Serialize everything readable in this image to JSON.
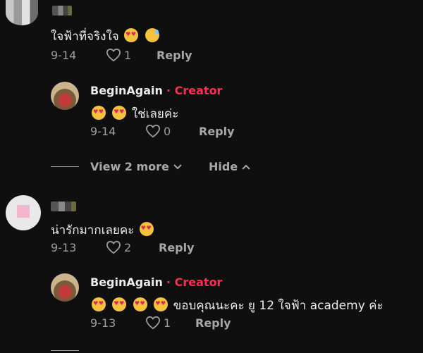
{
  "comments": [
    {
      "text": "ใจฟ้าที่จริงใจ",
      "emojis": [
        "heart-eyes-emoji",
        "sweat-smile-emoji"
      ],
      "date": "9-14",
      "likes": "1",
      "reply_label": "Reply",
      "replies": [
        {
          "username": "BeginAgain",
          "creator_label": "· Creator",
          "text": "ใช่เลยค่ะ",
          "emojis": [
            "heart-eyes-emoji",
            "heart-eyes-emoji"
          ],
          "date": "9-14",
          "likes": "0",
          "reply_label": "Reply"
        }
      ],
      "view_more_label": "View 2 more",
      "hide_label": "Hide"
    },
    {
      "text": "น่ารักมากเลยคะ",
      "emojis": [
        "heart-eyes-emoji"
      ],
      "date": "9-13",
      "likes": "2",
      "reply_label": "Reply",
      "replies": [
        {
          "username": "BeginAgain",
          "creator_label": "· Creator",
          "text": "ขอบคุณนะคะ ยู 12 ใจฟ้า academy ค่ะ",
          "emojis": [
            "heart-eyes-emoji",
            "heart-eyes-emoji",
            "heart-eyes-emoji",
            "heart-eyes-emoji"
          ],
          "date": "9-13",
          "likes": "1",
          "reply_label": "Reply"
        }
      ]
    }
  ],
  "colors": {
    "background": "#0f0f0f",
    "creator": "#fe2c55",
    "muted": "#9d9d9d"
  }
}
